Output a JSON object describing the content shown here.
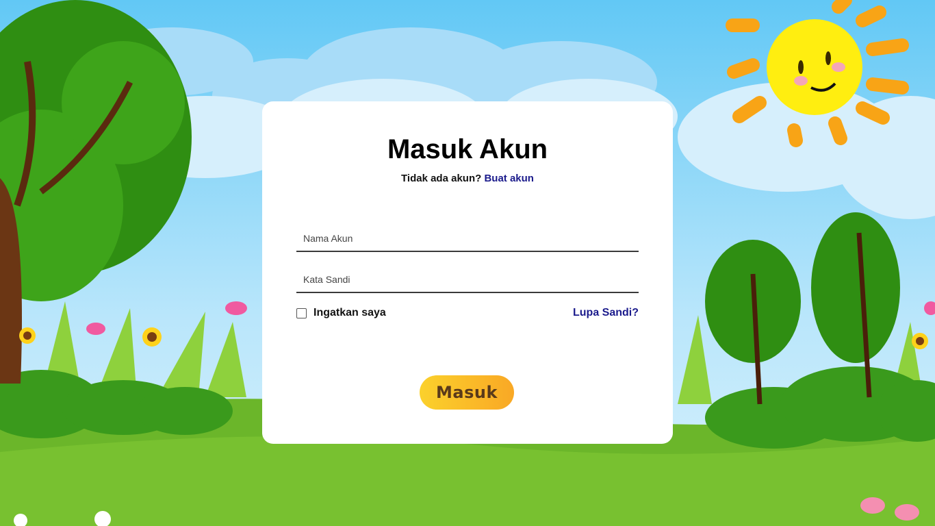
{
  "form": {
    "title": "Masuk Akun",
    "signup_prompt": "Tidak ada akun?",
    "signup_link": "Buat akun",
    "username_placeholder": "Nama Akun",
    "password_placeholder": "Kata Sandi",
    "remember_label": "Ingatkan saya",
    "forgot_link": "Lupa Sandi?",
    "submit_label": "Masuk"
  },
  "colors": {
    "sky": "#8fd3f7",
    "grass": "#6fbf2a",
    "card": "#ffffff",
    "link": "#1b1b8c",
    "button": "#fbc02d",
    "button_text": "#5a3a1a"
  }
}
